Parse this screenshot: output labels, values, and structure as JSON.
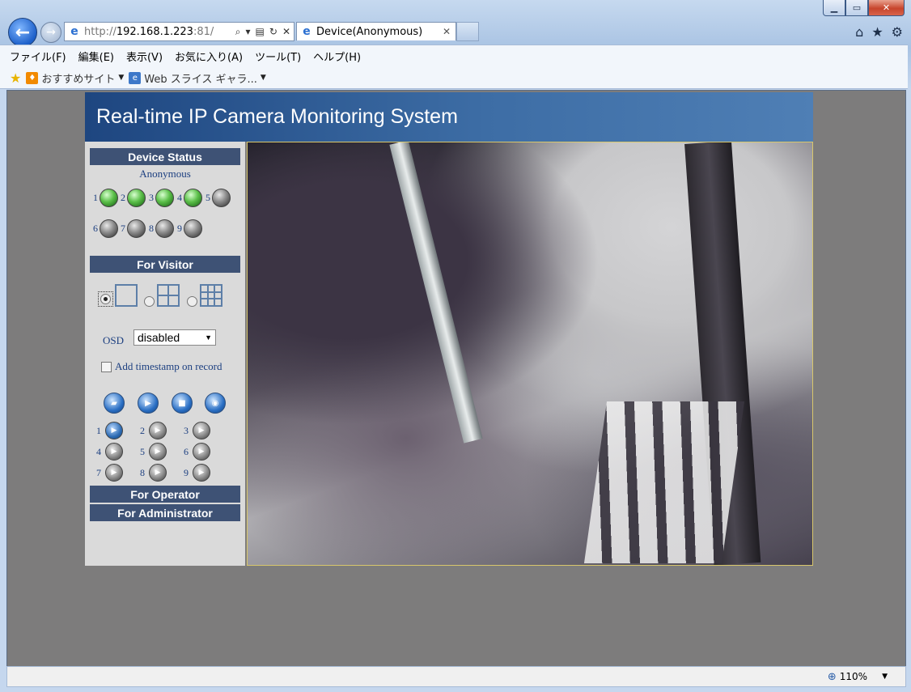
{
  "browser": {
    "address_prefix": "http://",
    "address_host": "192.168.1.223",
    "address_suffix": ":81/",
    "tab_title": "Device(Anonymous)"
  },
  "menu": [
    "ファイル(F)",
    "編集(E)",
    "表示(V)",
    "お気に入り(A)",
    "ツール(T)",
    "ヘルプ(H)"
  ],
  "favorites": {
    "suggested_sites": "おすすめサイト",
    "web_slice": "Web スライス ギャラ..."
  },
  "app": {
    "title": "Real-time IP Camera Monitoring System",
    "device_status_header": "Device Status",
    "user": "Anonymous",
    "leds": [
      {
        "num": "1",
        "on": true
      },
      {
        "num": "2",
        "on": true
      },
      {
        "num": "3",
        "on": true
      },
      {
        "num": "4",
        "on": true
      },
      {
        "num": "5",
        "on": false
      },
      {
        "num": "6",
        "on": false
      },
      {
        "num": "7",
        "on": false
      },
      {
        "num": "8",
        "on": false
      },
      {
        "num": "9",
        "on": false
      }
    ],
    "visitor_header": "For Visitor",
    "osd_label": "OSD",
    "osd_value": "disabled",
    "timestamp_label": "Add timestamp on record",
    "recorders": [
      "1",
      "2",
      "3",
      "4",
      "5",
      "6",
      "7",
      "8",
      "9"
    ],
    "operator_header": "For Operator",
    "admin_header": "For Administrator"
  },
  "status": {
    "zoom": "110%"
  }
}
